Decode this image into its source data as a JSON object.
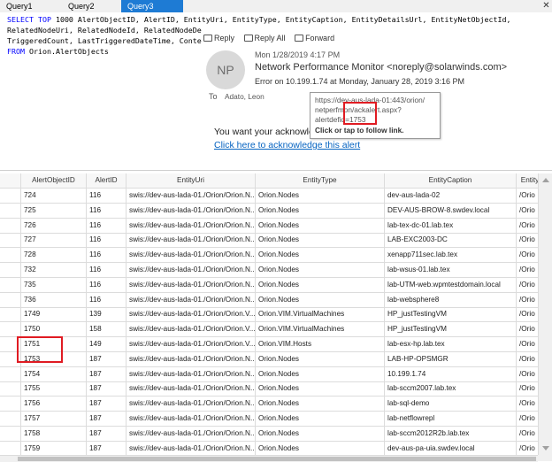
{
  "tabs": [
    {
      "label": "Query1",
      "active": false
    },
    {
      "label": "Query2",
      "active": false
    },
    {
      "label": "Query3",
      "active": true
    }
  ],
  "close_glyph": "✕",
  "sql": {
    "lines": [
      [
        {
          "t": "SELECT TOP",
          "kw": true
        },
        {
          "t": " 1000 AlertObjectID, AlertID, EntityUri, EntityType, EntityCaption, EntityDetailsUrl, EntityNetObjectId,"
        }
      ],
      [
        {
          "t": "RelatedNodeUri, RelatedNodeId, RelatedNodeDe"
        }
      ],
      [
        {
          "t": "TriggeredCount, LastTriggeredDateTime, Conte"
        }
      ],
      [
        {
          "t": "FROM",
          "kw": true
        },
        {
          "t": " Orion.AlertObjects"
        }
      ]
    ]
  },
  "email": {
    "toolbar": [
      {
        "label": "Reply",
        "icon": "reply-icon"
      },
      {
        "label": "Reply All",
        "icon": "reply-all-icon"
      },
      {
        "label": "Forward",
        "icon": "forward-icon"
      }
    ],
    "avatar_initials": "NP",
    "date": "Mon 1/28/2019 4:17 PM",
    "from": "Network Performance Monitor <noreply@solarwinds.com>",
    "subject": "Error on 10.199.1.74 at Monday, January 28, 2019 3:16 PM",
    "to_label": "To",
    "to_value": "Adato, Leon",
    "body_text": "You want your acknowleg",
    "link_text": "Click here to acknowledge this alert"
  },
  "tooltip": {
    "line1": "https://dev-aus-lada-01:443/orion/",
    "line2": "netperfmon/ackalert.aspx?",
    "line3": "alertdefid=1753",
    "line4": "Click or tap to follow link."
  },
  "grid": {
    "columns": [
      "AlertObjectID",
      "AlertID",
      "EntityUri",
      "EntityType",
      "EntityCaption",
      "Entity"
    ],
    "rows": [
      [
        "724",
        "116",
        "swis://dev-aus-lada-01./Orion/Orion.N...",
        "Orion.Nodes",
        "dev-aus-lada-02",
        "/Orio"
      ],
      [
        "725",
        "116",
        "swis://dev-aus-lada-01./Orion/Orion.N...",
        "Orion.Nodes",
        "DEV-AUS-BROW-8.swdev.local",
        "/Orio"
      ],
      [
        "726",
        "116",
        "swis://dev-aus-lada-01./Orion/Orion.N...",
        "Orion.Nodes",
        "lab-tex-dc-01.lab.tex",
        "/Orio"
      ],
      [
        "727",
        "116",
        "swis://dev-aus-lada-01./Orion/Orion.N...",
        "Orion.Nodes",
        "LAB-EXC2003-DC",
        "/Orio"
      ],
      [
        "728",
        "116",
        "swis://dev-aus-lada-01./Orion/Orion.N...",
        "Orion.Nodes",
        "xenapp711sec.lab.tex",
        "/Orio"
      ],
      [
        "732",
        "116",
        "swis://dev-aus-lada-01./Orion/Orion.N...",
        "Orion.Nodes",
        "lab-wsus-01.lab.tex",
        "/Orio"
      ],
      [
        "735",
        "116",
        "swis://dev-aus-lada-01./Orion/Orion.N...",
        "Orion.Nodes",
        "lab-UTM-web.wpmtestdomain.local",
        "/Orio"
      ],
      [
        "736",
        "116",
        "swis://dev-aus-lada-01./Orion/Orion.N...",
        "Orion.Nodes",
        "lab-websphere8",
        "/Orio"
      ],
      [
        "1749",
        "139",
        "swis://dev-aus-lada-01./Orion/Orion.V...",
        "Orion.VIM.VirtualMachines",
        "HP_justTestingVM",
        "/Orio"
      ],
      [
        "1750",
        "158",
        "swis://dev-aus-lada-01./Orion/Orion.V...",
        "Orion.VIM.VirtualMachines",
        "HP_justTestingVM",
        "/Orio"
      ],
      [
        "1751",
        "149",
        "swis://dev-aus-lada-01./Orion/Orion.V...",
        "Orion.VIM.Hosts",
        "lab-esx-hp.lab.tex",
        "/Orio"
      ],
      [
        "1753",
        "187",
        "swis://dev-aus-lada-01./Orion/Orion.N...",
        "Orion.Nodes",
        "LAB-HP-OPSMGR",
        "/Orio"
      ],
      [
        "1754",
        "187",
        "swis://dev-aus-lada-01./Orion/Orion.N...",
        "Orion.Nodes",
        "10.199.1.74",
        "/Orio"
      ],
      [
        "1755",
        "187",
        "swis://dev-aus-lada-01./Orion/Orion.N...",
        "Orion.Nodes",
        "lab-sccm2007.lab.tex",
        "/Orio"
      ],
      [
        "1756",
        "187",
        "swis://dev-aus-lada-01./Orion/Orion.N...",
        "Orion.Nodes",
        "lab-sql-demo",
        "/Orio"
      ],
      [
        "1757",
        "187",
        "swis://dev-aus-lada-01./Orion/Orion.N...",
        "Orion.Nodes",
        "lab-netflowrepl",
        "/Orio"
      ],
      [
        "1758",
        "187",
        "swis://dev-aus-lada-01./Orion/Orion.N...",
        "Orion.Nodes",
        "lab-sccm2012R2b.lab.tex",
        "/Orio"
      ],
      [
        "1759",
        "187",
        "swis://dev-aus-lada-01./Orion/Orion.N...",
        "Orion.Nodes",
        "dev-aus-pa-uia.swdev.local",
        "/Orio"
      ]
    ]
  },
  "colors": {
    "active_tab": "#1e7bd4",
    "sql_keyword": "#0000ff",
    "link": "#0563c1",
    "highlight_box": "#e01b22"
  }
}
